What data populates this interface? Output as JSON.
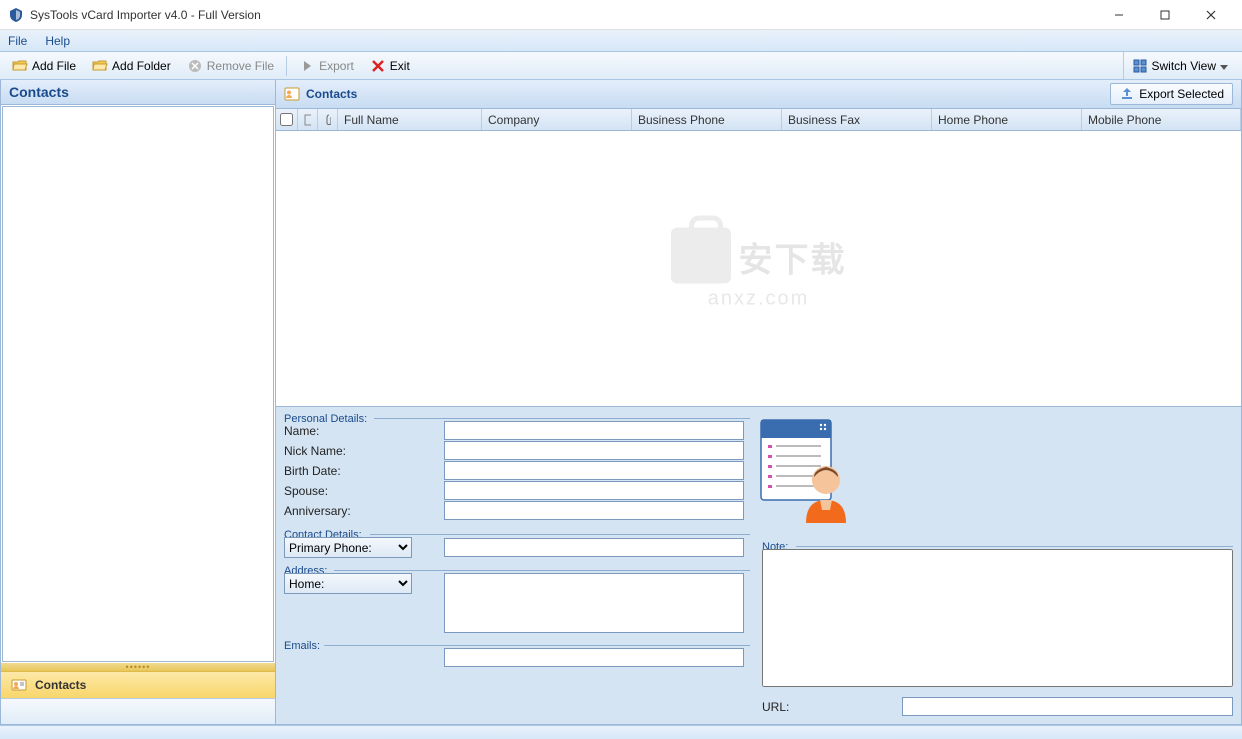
{
  "window": {
    "title": "SysTools vCard Importer v4.0 - Full Version"
  },
  "menubar": {
    "file": "File",
    "help": "Help"
  },
  "toolbar": {
    "add_file": "Add File",
    "add_folder": "Add Folder",
    "remove_file": "Remove File",
    "export": "Export",
    "exit": "Exit",
    "switch_view": "Switch View"
  },
  "sidebar": {
    "header": "Contacts",
    "contacts_btn": "Contacts"
  },
  "content": {
    "header": "Contacts",
    "export_selected": "Export Selected",
    "columns": {
      "full_name": "Full Name",
      "company": "Company",
      "business_phone": "Business Phone",
      "business_fax": "Business Fax",
      "home_phone": "Home Phone",
      "mobile_phone": "Mobile Phone"
    }
  },
  "details": {
    "personal_details": "Personal Details:",
    "name": "Name:",
    "nick_name": "Nick Name:",
    "birth_date": "Birth Date:",
    "spouse": "Spouse:",
    "anniversary": "Anniversary:",
    "contact_details": "Contact Details:",
    "primary_phone": "Primary Phone:",
    "address": "Address:",
    "home": "Home:",
    "emails": "Emails:",
    "note": "Note:",
    "url": "URL:"
  },
  "watermark": {
    "line1": "安下载",
    "line2": "anxz.com"
  }
}
